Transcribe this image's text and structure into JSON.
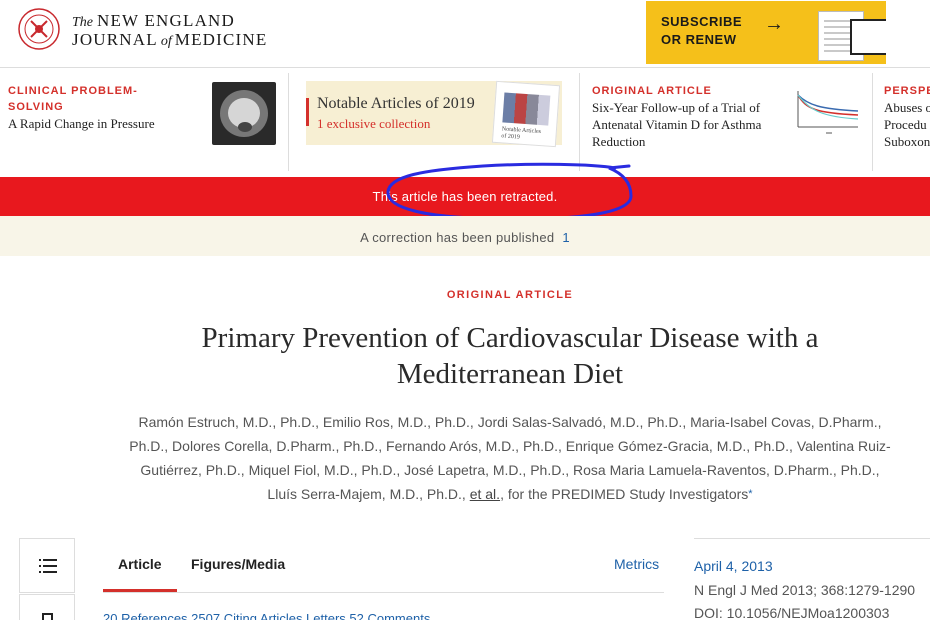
{
  "header": {
    "logo_the": "The",
    "logo_line1": "NEW ENGLAND",
    "logo_journal": "JOURNAL",
    "logo_of": "of",
    "logo_medicine": "MEDICINE",
    "subscribe_line1": "SUBSCRIBE",
    "subscribe_line2": "OR RENEW",
    "subscribe_bg": "#f5c01a"
  },
  "carousel": {
    "card1": {
      "kicker_line1": "CLINICAL PROBLEM-",
      "kicker_line2": "SOLVING",
      "title": "A Rapid Change in Pressure"
    },
    "notable": {
      "title": "Notable Articles of 2019",
      "subtitle": "1 exclusive collection"
    },
    "card3": {
      "kicker": "ORIGINAL ARTICLE",
      "title": "Six-Year Follow-up of a Trial of Antenatal Vitamin D for Asthma Reduction"
    },
    "card4": {
      "kicker": "PERSPE",
      "title_line1": "Abuses o",
      "title_line2": "Procedu",
      "title_line3": "Suboxon"
    }
  },
  "banners": {
    "retracted": "This article has been retracted.",
    "correction": "A correction has been published",
    "correction_count": "1",
    "retracted_color": "#e8181e"
  },
  "article": {
    "type": "ORIGINAL ARTICLE",
    "title": "Primary Prevention of Cardiovascular Disease with a Mediterranean Diet",
    "authors_line1": "Ramón Estruch, M.D., Ph.D., Emilio Ros, M.D., Ph.D., Jordi Salas-Salvadó, M.D., Ph.D., Maria-Isabel Covas, D.Pharm.,",
    "authors_line2": "Ph.D., Dolores Corella, D.Pharm., Ph.D., Fernando Arós, M.D., Ph.D., Enrique Gómez-Gracia, M.D., Ph.D., Valentina Ruiz-",
    "authors_line3": "Gutiérrez, Ph.D., Miquel Fiol, M.D., Ph.D., José Lapetra, M.D., Ph.D., Rosa Maria Lamuela-Raventos, D.Pharm., Ph.D.,",
    "authors_line4": "Lluís Serra-Majem, M.D., Ph.D.,",
    "et_al": "et al.",
    "for_group": ", for the PREDIMED Study Investigators",
    "star": "*"
  },
  "tabs": {
    "article": "Article",
    "figures": "Figures/Media",
    "metrics": "Metrics"
  },
  "meta": {
    "date": "April 4, 2013",
    "citation": "N Engl J Med 2013; 368:1279-1290",
    "doi": "DOI: 10.1056/NEJMoa1200303"
  },
  "stats_partial": "20 References   2507 Citing Articles   Letters   52 Comments",
  "accent_color": "#d4302b",
  "link_color": "#1e61a8"
}
